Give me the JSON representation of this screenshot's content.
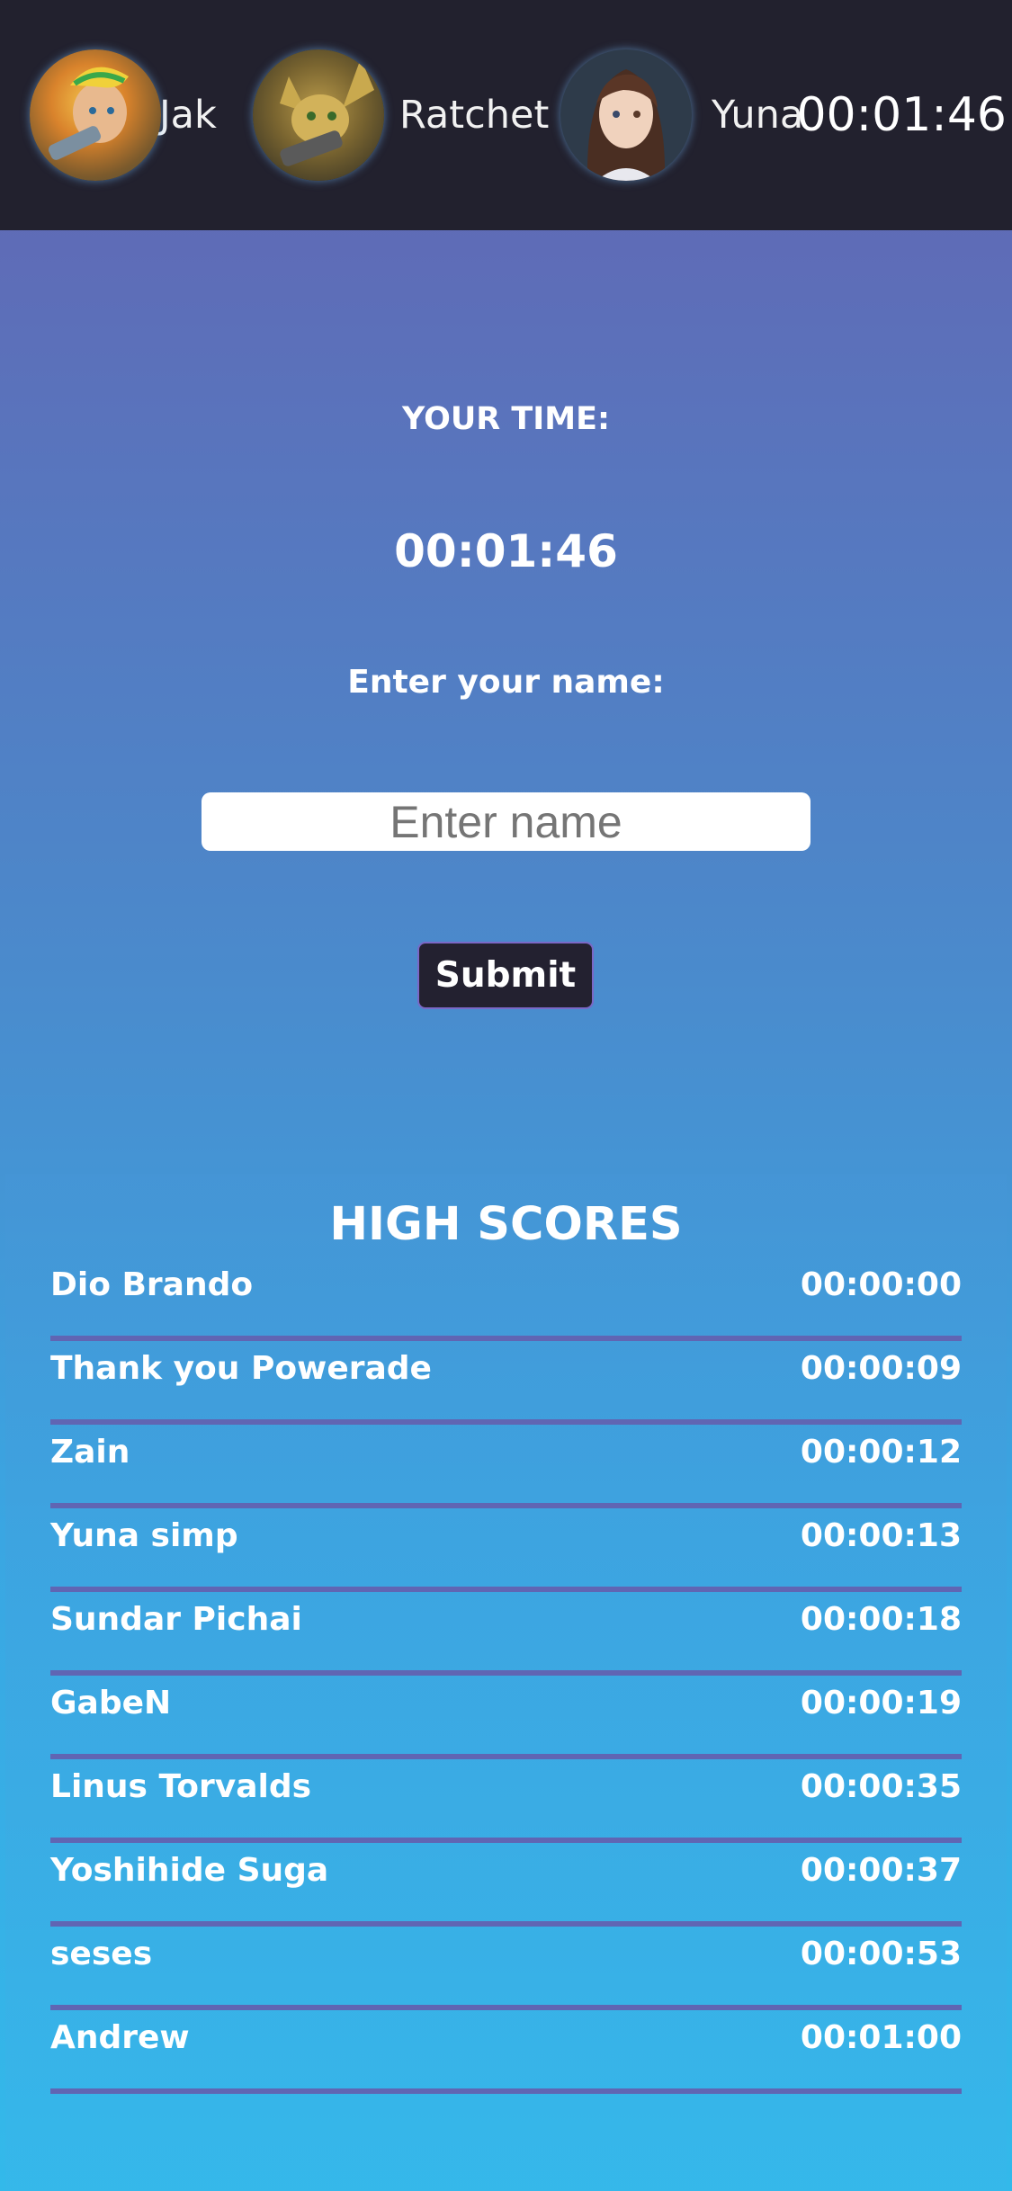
{
  "header": {
    "characters": [
      {
        "name": "Jak",
        "avatar_icon": "jak-portrait-icon",
        "bg": "#c8752a"
      },
      {
        "name": "Ratchet",
        "avatar_icon": "ratchet-portrait-icon",
        "bg": "#6a5a2a"
      },
      {
        "name": "Yuna",
        "avatar_icon": "yuna-portrait-icon",
        "bg": "#3b2a24"
      }
    ],
    "timer": "00:01:46"
  },
  "result": {
    "your_time_label": "YOUR TIME:",
    "your_time_value": "00:01:46",
    "enter_name_label": "Enter your name:",
    "name_input_placeholder": "Enter name",
    "name_input_value": "",
    "submit_label": "Submit"
  },
  "high_scores": {
    "title": "HIGH SCORES",
    "rows": [
      {
        "name": "Dio Brando",
        "time": "00:00:00"
      },
      {
        "name": "Thank you Powerade",
        "time": "00:00:09"
      },
      {
        "name": "Zain",
        "time": "00:00:12"
      },
      {
        "name": "Yuna simp",
        "time": "00:00:13"
      },
      {
        "name": "Sundar Pichai",
        "time": "00:00:18"
      },
      {
        "name": "GabeN",
        "time": "00:00:19"
      },
      {
        "name": "Linus Torvalds",
        "time": "00:00:35"
      },
      {
        "name": "Yoshihide Suga",
        "time": "00:00:37"
      },
      {
        "name": "seses",
        "time": "00:00:53"
      },
      {
        "name": "Andrew",
        "time": "00:01:00"
      }
    ]
  },
  "colors": {
    "header_bg": "#22212e",
    "gradient_top": "#6562b0",
    "gradient_bottom": "#33b9ea",
    "row_divider": "#6065b3",
    "button_bg": "#232130"
  }
}
